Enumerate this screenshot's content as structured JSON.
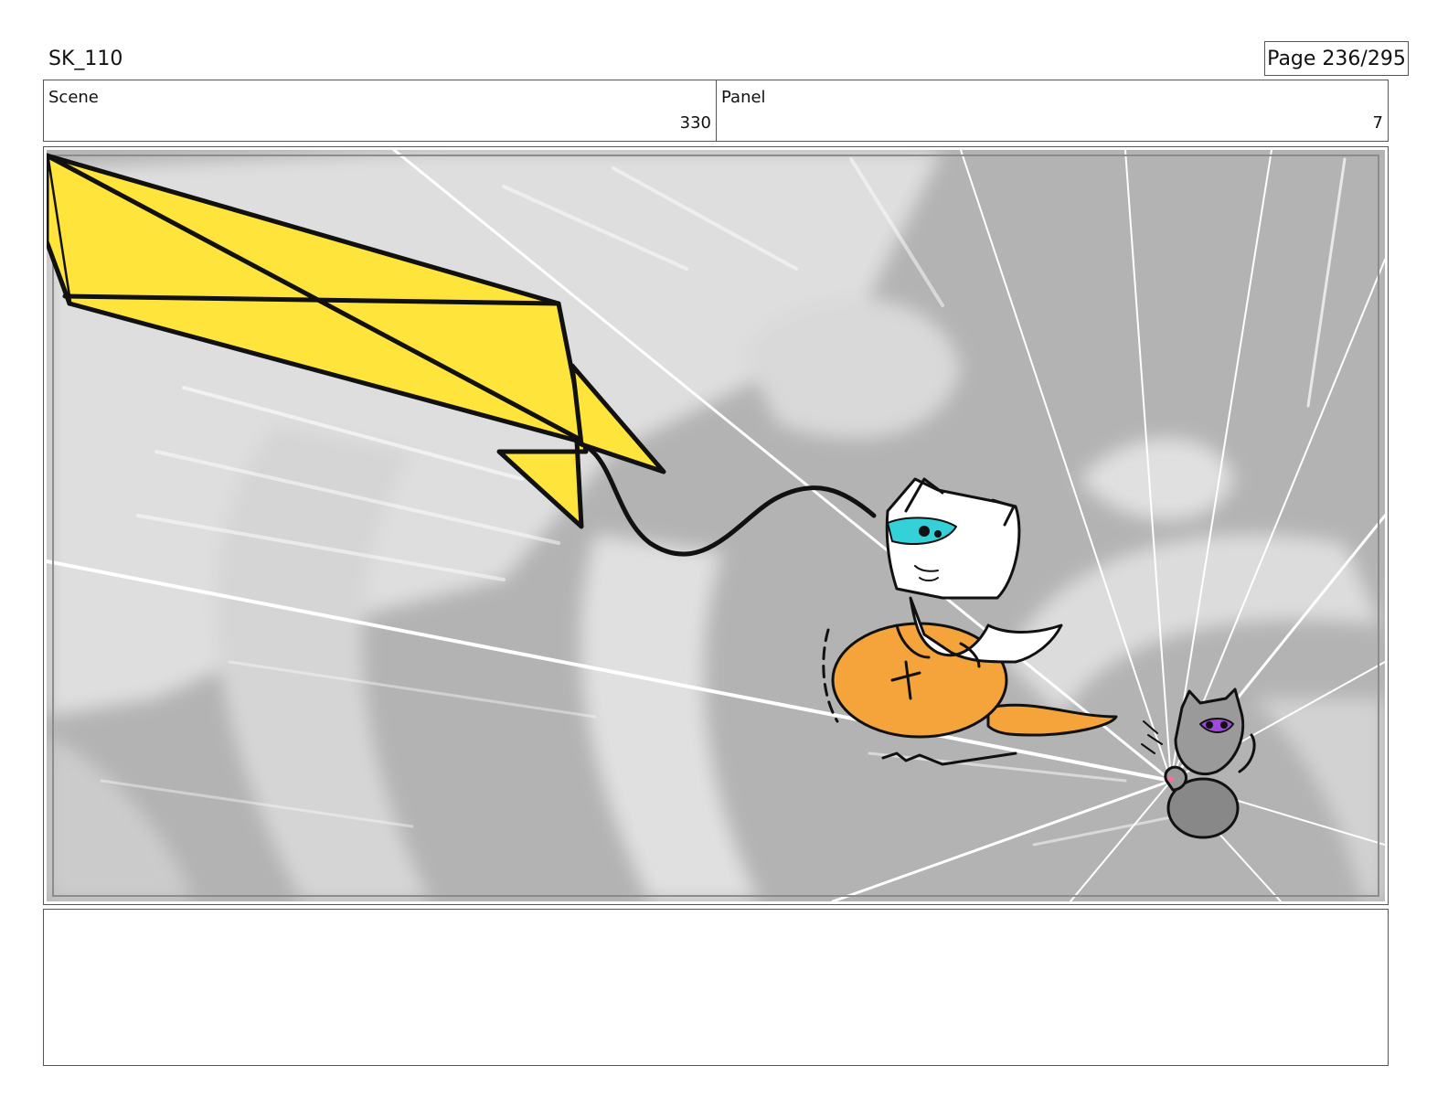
{
  "header": {
    "doc_id": "SK_110",
    "page": "Page 236/295"
  },
  "meta": {
    "scene_label": "Scene",
    "scene_value": "330",
    "panel_label": "Panel",
    "panel_value": "7"
  },
  "notes": {
    "text": ""
  },
  "colors": {
    "kite": "#ffe43c",
    "rat": "#f5a43c",
    "glasses": "#34d1d8",
    "eyes_purple": "#a14ad9",
    "background": "#b3b3b3"
  }
}
